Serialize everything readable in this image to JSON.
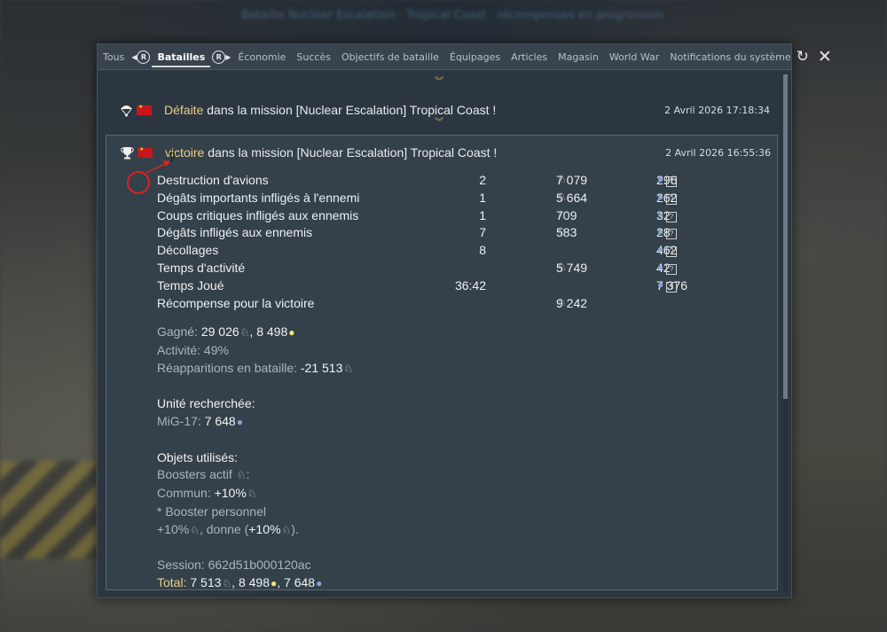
{
  "background": {
    "banner_text": "Bataille Nuclear Escalation · Tropical Coast · récompenses en progression"
  },
  "tabs": [
    {
      "label": "Tous",
      "active": false
    },
    {
      "label": "Batailles",
      "active": true
    },
    {
      "label": "Économie",
      "active": false
    },
    {
      "label": "Succès",
      "active": false
    },
    {
      "label": "Objectifs de bataille",
      "active": false
    },
    {
      "label": "Équipages",
      "active": false
    },
    {
      "label": "Articles",
      "active": false
    },
    {
      "label": "Magasin",
      "active": false
    },
    {
      "label": "World War",
      "active": false
    },
    {
      "label": "Notifications du système",
      "active": false
    }
  ],
  "tab_nav": {
    "prev_icon": "R",
    "next_icon": "R"
  },
  "actions": {
    "refresh_icon": "refresh-icon",
    "close_icon": "close-icon"
  },
  "entries": [
    {
      "icon": "parachute-icon",
      "status": "Défaite",
      "text": " dans la mission [Nuclear Escalation] Tropical Coast !",
      "date": "2 Avril 2026 17:18:34"
    },
    {
      "icon": "trophy-icon",
      "status": "victoire",
      "text": " dans la mission [Nuclear Escalation] Tropical Coast !",
      "date": "2 Avril 2026 16:55:36"
    }
  ],
  "stats": [
    {
      "label": "Destruction d'avions",
      "count": "2",
      "sl": "7 079",
      "rp": "296",
      "help": true
    },
    {
      "label": "Dégâts importants infligés à l'ennemi",
      "count": "1",
      "sl": "5 664",
      "rp": "262",
      "help": true
    },
    {
      "label": "Coups critiques infligés aux ennemis",
      "count": "1",
      "sl": "709",
      "rp": "32",
      "help": true
    },
    {
      "label": "Dégâts infligés aux ennemis",
      "count": "7",
      "sl": "583",
      "rp": "28",
      "help": true
    },
    {
      "label": "Décollages",
      "count": "8",
      "sl": "",
      "rp": "462",
      "help": true
    },
    {
      "label": "Temps d'activité",
      "count": "",
      "sl": "5 749",
      "rp": "42",
      "help": true
    },
    {
      "label": "Temps Joué",
      "count": "36:42",
      "sl": "",
      "rp": "7 376",
      "help": true
    },
    {
      "label": "Récompense pour la victoire",
      "count": "",
      "sl": "9 242",
      "rp": "",
      "help": false
    }
  ],
  "details": {
    "earned_label": "Gagné: ",
    "earned_sl": "29 026",
    "earned_rp": "8 498",
    "activity": "Activité: 49%",
    "respawn_label": "Réapparitions en bataille: ",
    "respawn_value": "-21 513",
    "research_heading": "Unité recherchée:",
    "research_unit": "MiG-17: ",
    "research_value": "7 648",
    "items_heading": "Objets utilisés:",
    "boosters_label": "Boosters actif ",
    "common_label": "Commun: ",
    "common_value": "+10%",
    "personal_label": "* Booster personnel",
    "personal_value": "+10%",
    "personal_give_label": ", donne (",
    "personal_give_value": "+10%",
    "personal_close": ").",
    "session": "Session: 662d51b000120ac",
    "total_label": "Total: ",
    "total_sl": "7 513",
    "total_rp_bulb": "8 498",
    "total_rp": "7 648"
  },
  "annotation": {
    "question_mark": "?"
  },
  "scrollbar_position": 0.0
}
